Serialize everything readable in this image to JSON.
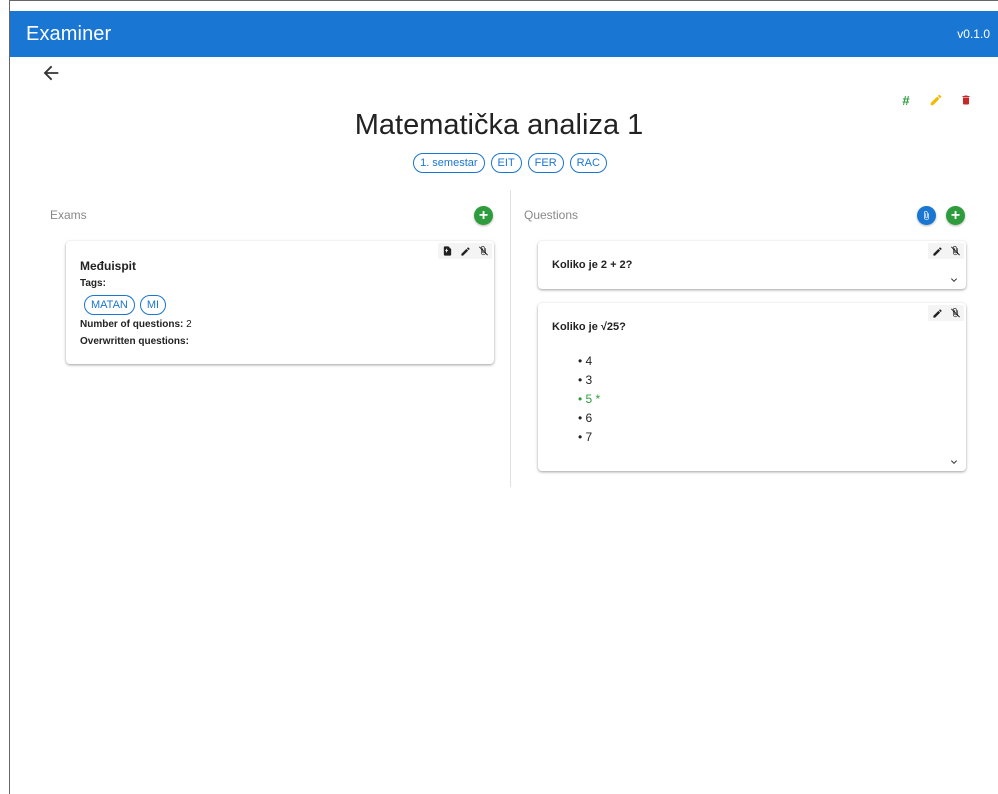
{
  "app": {
    "title": "Examiner",
    "version": "v0.1.0"
  },
  "course": {
    "title": "Matematička analiza 1",
    "tags": [
      "1. semestar",
      "EIT",
      "FER",
      "RAC"
    ]
  },
  "colors": {
    "primary": "#1976d2",
    "success": "#2e9c3c",
    "warning": "#f5b800",
    "danger": "#c62828"
  },
  "exams": {
    "label": "Exams",
    "items": [
      {
        "title": "Međuispit",
        "tags_label": "Tags:",
        "tags": [
          "MATAN",
          "MI"
        ],
        "num_questions_label": "Number of questions:",
        "num_questions": "2",
        "overwritten_label": "Overwritten questions:"
      }
    ]
  },
  "questions": {
    "label": "Questions",
    "items": [
      {
        "title": "Koliko je 2 + 2?"
      },
      {
        "title": "Koliko je √25?",
        "answers": [
          {
            "text": "4",
            "correct": false
          },
          {
            "text": "3",
            "correct": false
          },
          {
            "text": "5 *",
            "correct": true
          },
          {
            "text": "6",
            "correct": false
          },
          {
            "text": "7",
            "correct": false
          }
        ]
      }
    ]
  },
  "icons": {
    "back": "arrow-left-icon",
    "hash": "hash-icon",
    "edit": "pencil-icon",
    "delete": "trash-icon",
    "add": "plus-icon",
    "file": "file-icon",
    "detach": "clip-off-icon",
    "expand": "chevron-down-icon"
  },
  "fab_add_label": "+"
}
